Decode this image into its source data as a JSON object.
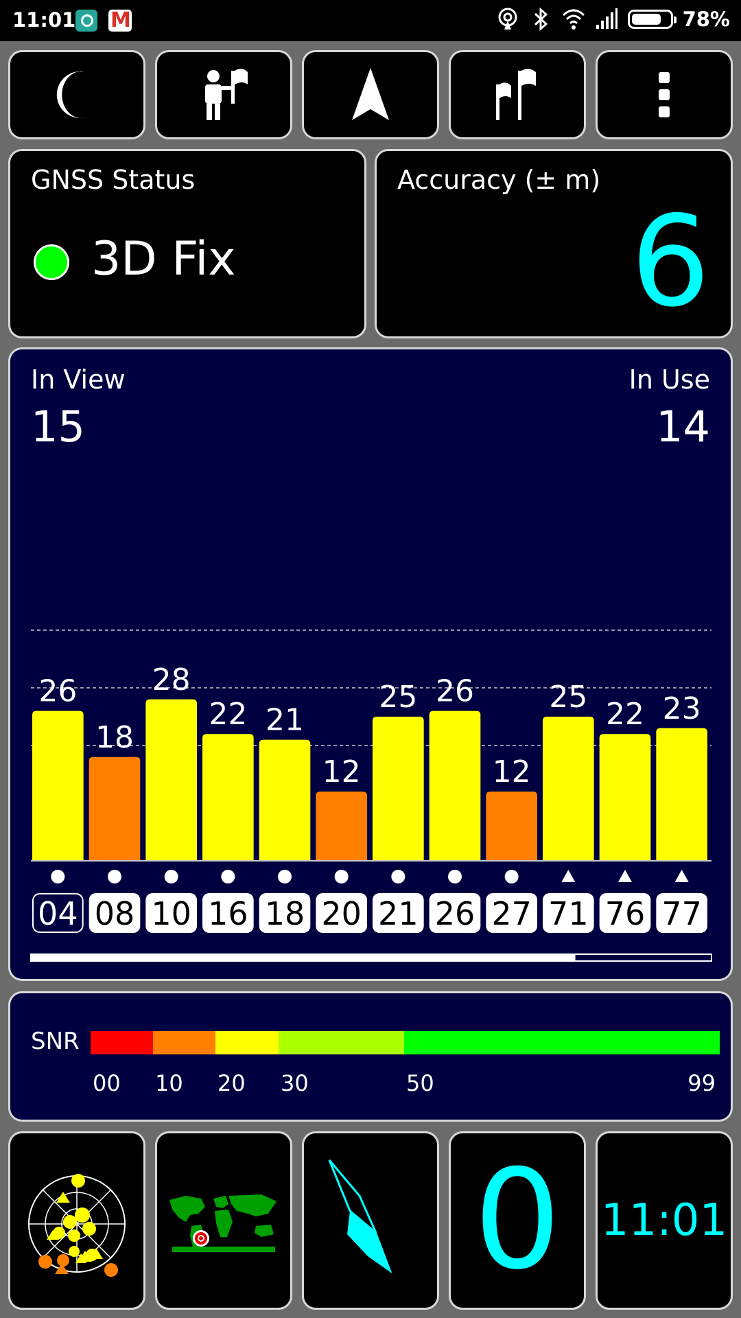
{
  "status_bar": {
    "time": "11:01",
    "battery_text": "78%",
    "battery_level": 0.78,
    "icons": [
      "hotspot-icon",
      "bluetooth-icon",
      "wifi-icon",
      "signal-icon",
      "battery-icon"
    ],
    "notification_icons": [
      "app-notification-icon",
      "gmail-icon"
    ]
  },
  "toolbar": {
    "buttons": [
      {
        "name": "night-mode-button",
        "icon": "moon-icon"
      },
      {
        "name": "waypoint-button",
        "icon": "person-flag-icon"
      },
      {
        "name": "navigate-button",
        "icon": "navigation-arrow-icon"
      },
      {
        "name": "flags-button",
        "icon": "flags-icon"
      },
      {
        "name": "more-menu-button",
        "icon": "more-vertical-icon"
      }
    ]
  },
  "gnss_status": {
    "title": "GNSS Status",
    "fix_text": "3D Fix",
    "fix_color": "#00ff00"
  },
  "accuracy": {
    "title": "Accuracy (± m)",
    "value": "6",
    "color": "#00ffff"
  },
  "satellites": {
    "in_view_label": "In View",
    "in_view_value": "15",
    "in_use_label": "In Use",
    "in_use_value": "14",
    "scroll_position": 0.8
  },
  "chart_data": {
    "type": "bar",
    "categories": [
      "04",
      "08",
      "10",
      "16",
      "18",
      "20",
      "21",
      "26",
      "27",
      "71",
      "76",
      "77"
    ],
    "values": [
      26,
      18,
      28,
      22,
      21,
      12,
      25,
      26,
      12,
      25,
      22,
      23
    ],
    "markers": [
      "circle",
      "circle",
      "circle",
      "circle",
      "circle",
      "circle",
      "circle",
      "circle",
      "circle",
      "triangle",
      "triangle",
      "triangle"
    ],
    "in_use": [
      false,
      true,
      true,
      true,
      true,
      true,
      true,
      true,
      true,
      true,
      true,
      true
    ],
    "ylim": [
      0,
      50
    ],
    "gridlines": [
      20,
      40
    ],
    "grid": true,
    "colors": {
      "high": "#ffff00",
      "low": "#ff8000"
    }
  },
  "snr_legend": {
    "label": "SNR",
    "ticks": [
      "00",
      "10",
      "20",
      "30",
      "50",
      "99"
    ],
    "segments": [
      {
        "from": 0,
        "to": 10,
        "color": "#ff0000"
      },
      {
        "from": 10,
        "to": 20,
        "color": "#ff8000"
      },
      {
        "from": 20,
        "to": 30,
        "color": "#ffff00"
      },
      {
        "from": 30,
        "to": 50,
        "color": "#aaff00"
      },
      {
        "from": 50,
        "to": 99,
        "color": "#00ff00"
      }
    ]
  },
  "bottom_bar": {
    "tiles": [
      {
        "name": "skyplot-button",
        "icon": "skyplot-icon"
      },
      {
        "name": "world-map-button",
        "icon": "world-map-icon"
      },
      {
        "name": "compass-button",
        "icon": "compass-icon"
      }
    ],
    "count_value": "0",
    "time_value": "11:01"
  }
}
